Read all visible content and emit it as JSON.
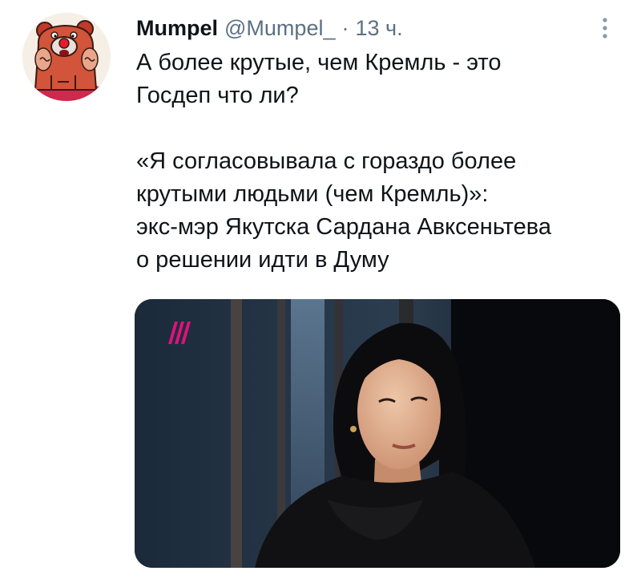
{
  "tweet": {
    "author": {
      "display_name": "Mumpel",
      "handle": "@Mumpel_",
      "avatar_icon": "cartoon-bear-avatar-icon"
    },
    "separator": "·",
    "time": "13 ч.",
    "menu_icon": "more-vertical-icon",
    "text": {
      "comment": "А более крутые, чем Кремль - это\nГосдеп что ли?",
      "quote": "«Я согласовывала с гораздо более\nкрутыми людьми (чем Кремль)»:\nэкс-мэр Якутска Сардана Авксеньтева\nо решении идти в Думу"
    },
    "media": {
      "type": "photo",
      "channel_logo_icon": "dozhd-tv-logo-icon",
      "accent_color": "#e0117a"
    }
  }
}
